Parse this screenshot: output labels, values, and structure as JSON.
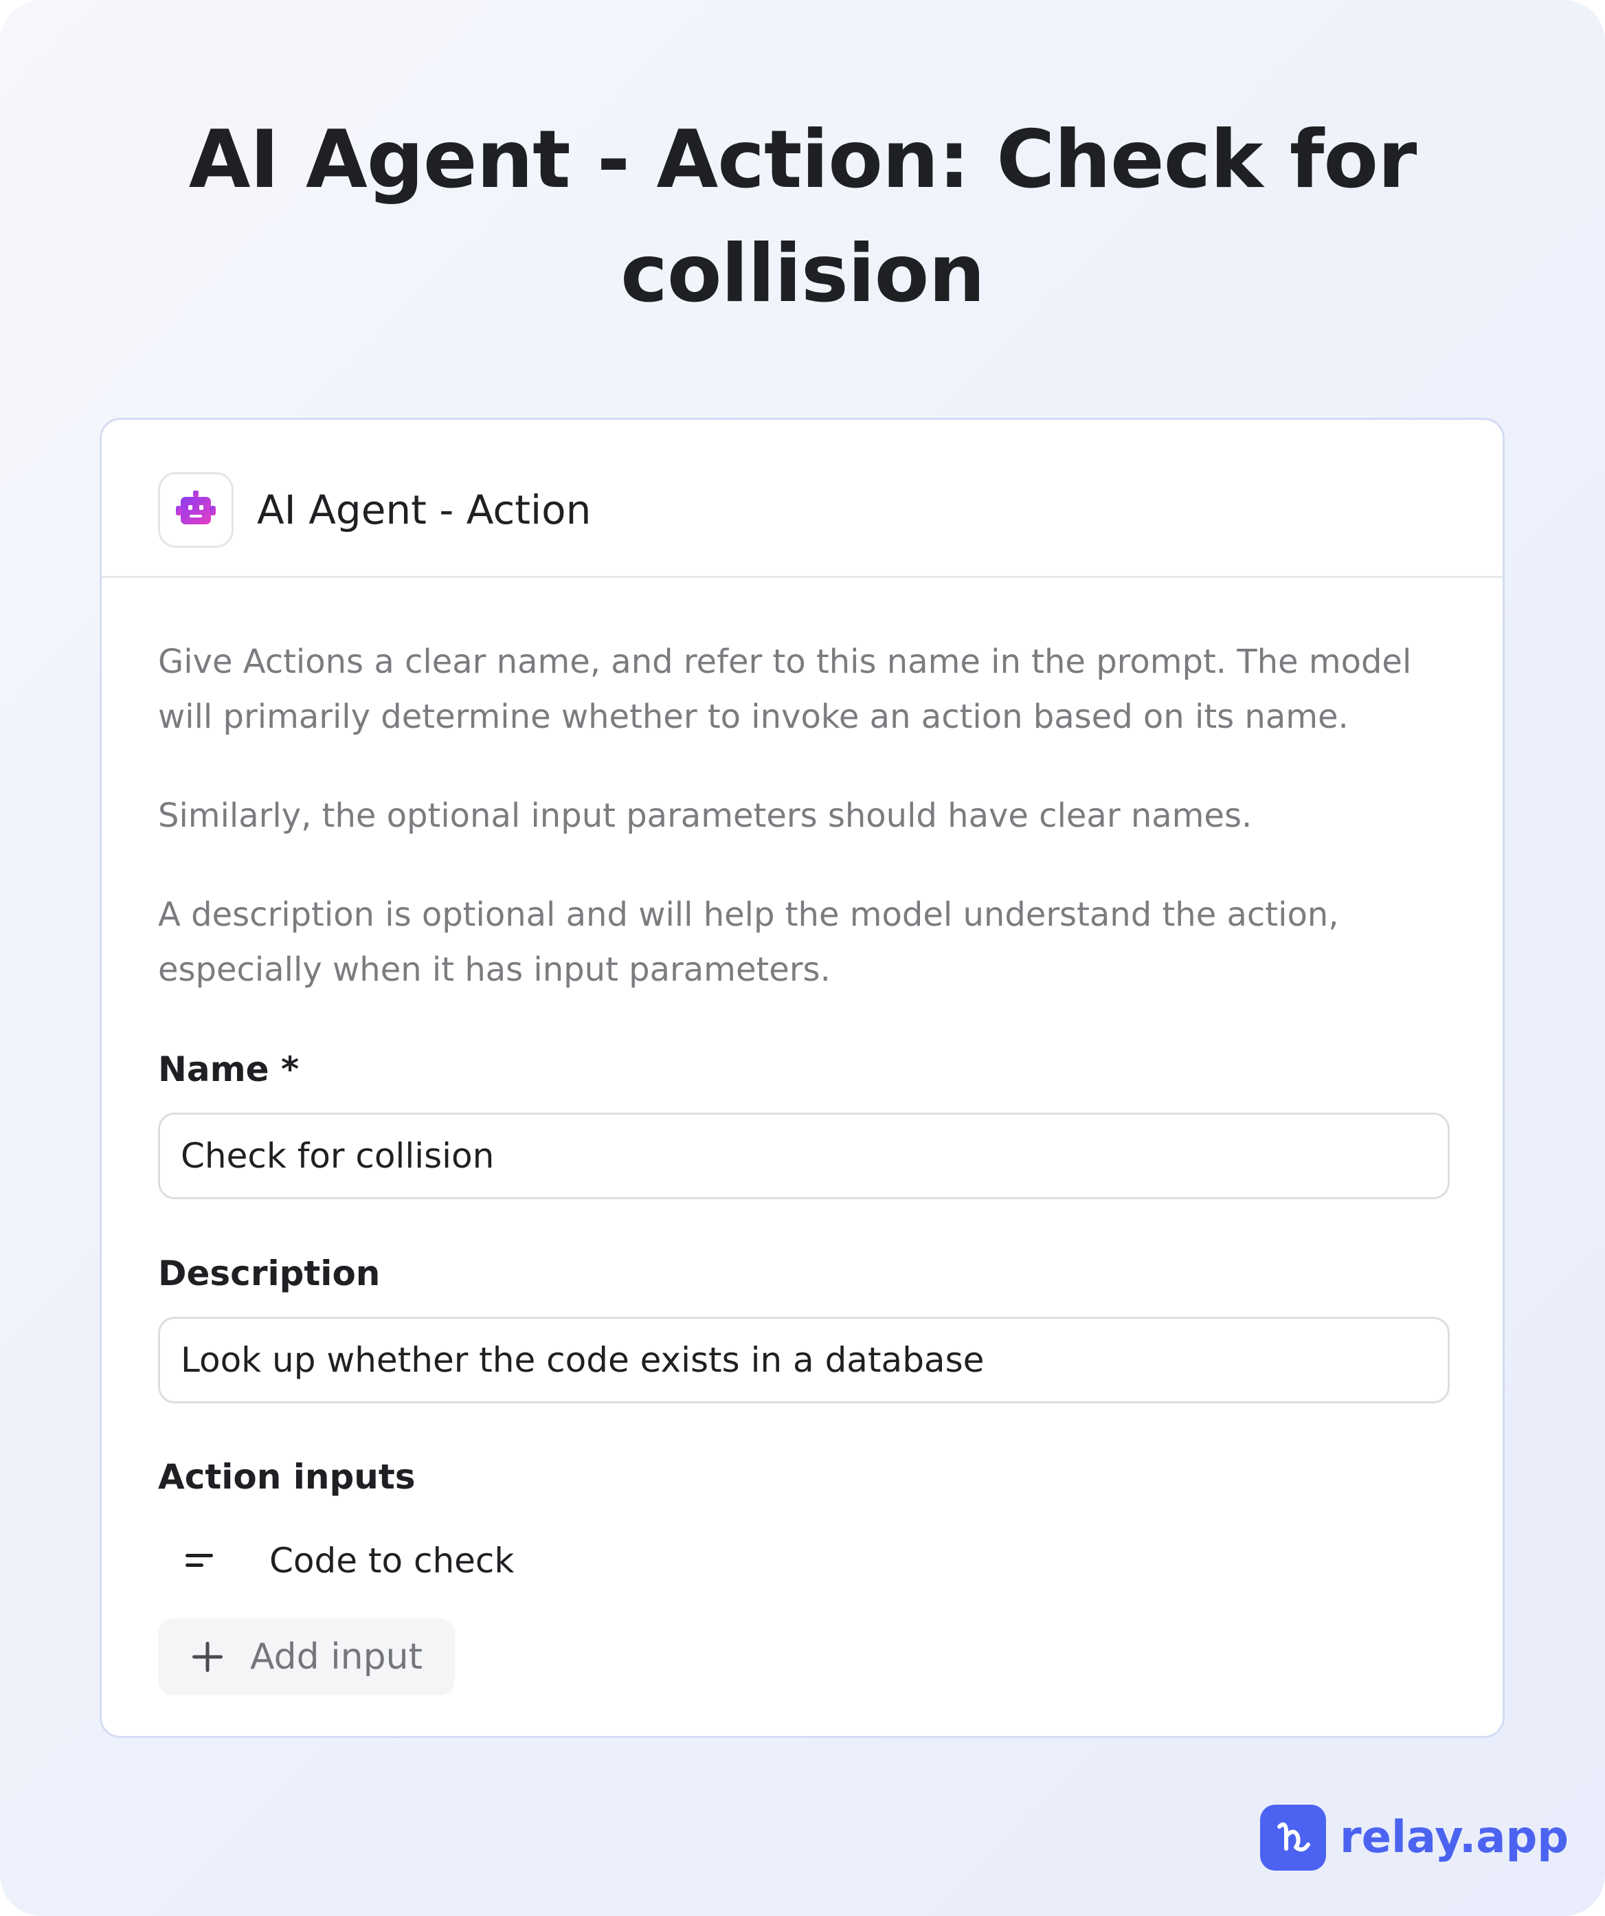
{
  "page": {
    "title": "AI Agent - Action: Check for collision"
  },
  "card": {
    "title": "AI Agent - Action",
    "icon": "robot-icon",
    "help_text": [
      "Give Actions a clear name, and refer to this name in the prompt. The model will primarily determine whether to invoke an action based on its name.",
      "Similarly, the optional input parameters should have clear names.",
      "A description is optional and will help the model understand the action, especially when it has input parameters."
    ],
    "name_field": {
      "label": "Name *",
      "value": "Check for collision"
    },
    "description_field": {
      "label": "Description",
      "value": "Look up whether the code exists in a database"
    },
    "action_inputs": {
      "label": "Action inputs",
      "items": [
        {
          "icon": "text-lines-icon",
          "label": "Code to check"
        }
      ],
      "add_button_label": "Add input"
    }
  },
  "brand": {
    "name": "relay.app",
    "color": "#4b63f0"
  },
  "colors": {
    "robot_gradient_start": "#8b3cf0",
    "robot_gradient_end": "#e63fc4",
    "card_border": "#d4dcf4",
    "muted_text": "#7a7c80"
  }
}
